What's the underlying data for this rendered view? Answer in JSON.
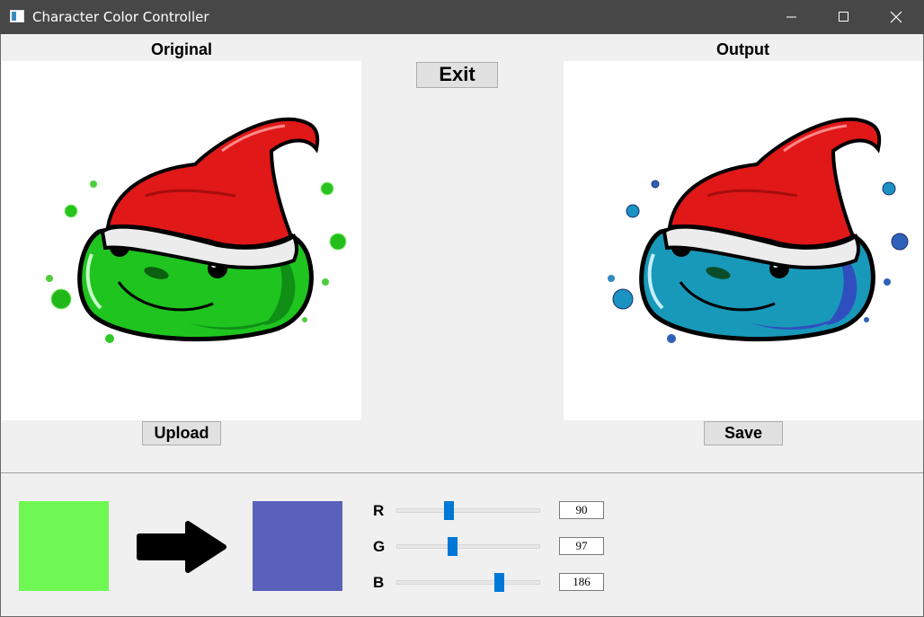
{
  "window": {
    "title": "Character Color Controller"
  },
  "labels": {
    "original": "Original",
    "output": "Output"
  },
  "buttons": {
    "exit": "Exit",
    "upload": "Upload",
    "save": "Save"
  },
  "color_controls": {
    "source_color": "#6ff854",
    "target_color": "#5a61ba",
    "sliders": [
      {
        "label": "R",
        "value": 90,
        "min": 0,
        "max": 255
      },
      {
        "label": "G",
        "value": 97,
        "min": 0,
        "max": 255
      },
      {
        "label": "B",
        "value": 186,
        "min": 0,
        "max": 255
      }
    ]
  },
  "colors": {
    "titlebar": "#474747",
    "slider_accent": "#0078d7",
    "slime_original": "#1fc41f",
    "slime_output": "#1899b9",
    "hat": "#e01818"
  }
}
